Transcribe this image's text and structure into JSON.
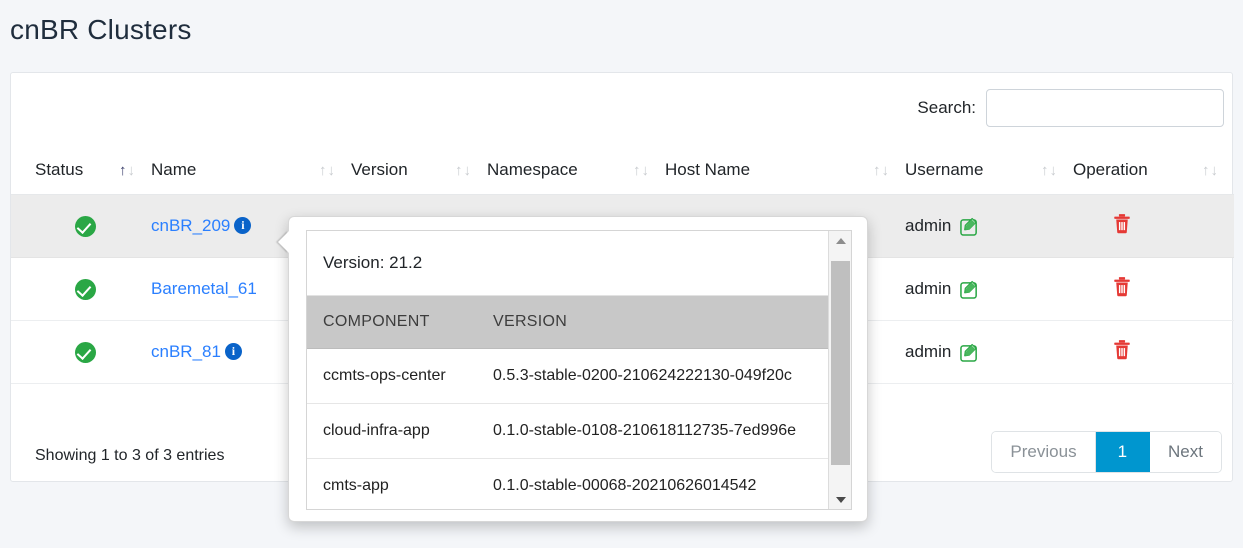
{
  "page": {
    "title": "cnBR Clusters",
    "background_color": "#f4f6f9"
  },
  "search": {
    "label": "Search:",
    "value": "",
    "placeholder": ""
  },
  "table": {
    "columns": [
      {
        "label": "Status",
        "sort": "ascending"
      },
      {
        "label": "Name",
        "sort": "none"
      },
      {
        "label": "Version",
        "sort": "none"
      },
      {
        "label": "Namespace",
        "sort": "none"
      },
      {
        "label": "Host Name",
        "sort": "none"
      },
      {
        "label": "Username",
        "sort": "none"
      },
      {
        "label": "Operation",
        "sort": "none"
      }
    ],
    "sort_icon": {
      "up": "↑",
      "down": "↓"
    },
    "rows": [
      {
        "status": "ok",
        "name": "cnBR_209",
        "has_info_icon": true,
        "version": "",
        "namespace": "",
        "host_name": "",
        "username": "admin",
        "highlighted": true
      },
      {
        "status": "ok",
        "name": "Baremetal_61",
        "has_info_icon": false,
        "version": "",
        "namespace": "",
        "host_name": "",
        "username": "admin",
        "highlighted": false
      },
      {
        "status": "ok",
        "name": "cnBR_81",
        "has_info_icon": true,
        "version": "",
        "namespace": "",
        "host_name": "",
        "username": "admin",
        "highlighted": false
      }
    ]
  },
  "footer": {
    "info": "Showing 1 to 3 of 3 entries",
    "pagination": {
      "previous": "Previous",
      "pages": [
        "1"
      ],
      "next": "Next",
      "active_page": "1",
      "active_color": "#0096cf"
    }
  },
  "popover": {
    "version_label": "Version: 21.2",
    "columns": [
      "COMPONENT",
      "VERSION"
    ],
    "rows": [
      {
        "component": "ccmts-ops-center",
        "version": "0.5.3-stable-0200-210624222130-049f20c"
      },
      {
        "component": "cloud-infra-app",
        "version": "0.1.0-stable-0108-210618112735-7ed996e"
      },
      {
        "component": "cmts-app",
        "version": "0.1.0-stable-00068-20210626014542"
      }
    ]
  },
  "colors": {
    "status_ok": "#2aa745",
    "link": "#2a7fff",
    "info_icon": "#0a63c9",
    "edit_icon": "#2aa745",
    "delete_icon": "#e53935",
    "pagination_active": "#0096cf"
  }
}
